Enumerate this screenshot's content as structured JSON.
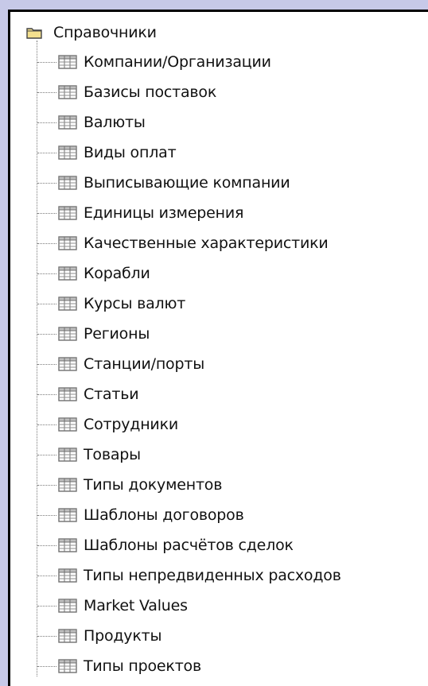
{
  "tree": {
    "root": {
      "label": "Справочники",
      "icon": "folder-icon"
    },
    "items": [
      {
        "label": "Компании/Организации",
        "icon": "table-icon"
      },
      {
        "label": "Базисы поставок",
        "icon": "table-icon"
      },
      {
        "label": "Валюты",
        "icon": "table-icon"
      },
      {
        "label": "Виды оплат",
        "icon": "table-icon"
      },
      {
        "label": "Выписывающие компании",
        "icon": "table-icon"
      },
      {
        "label": "Единицы измерения",
        "icon": "table-icon"
      },
      {
        "label": "Качественные характеристики",
        "icon": "table-icon"
      },
      {
        "label": "Корабли",
        "icon": "table-icon"
      },
      {
        "label": "Курсы валют",
        "icon": "table-icon"
      },
      {
        "label": "Регионы",
        "icon": "table-icon"
      },
      {
        "label": "Станции/порты",
        "icon": "table-icon"
      },
      {
        "label": "Статьи",
        "icon": "table-icon"
      },
      {
        "label": "Сотрудники",
        "icon": "table-icon"
      },
      {
        "label": "Товары",
        "icon": "table-icon"
      },
      {
        "label": "Типы документов",
        "icon": "table-icon"
      },
      {
        "label": "Шаблоны договоров",
        "icon": "table-icon"
      },
      {
        "label": "Шаблоны расчётов сделок",
        "icon": "table-icon"
      },
      {
        "label": "Типы непредвиденных расходов",
        "icon": "table-icon"
      },
      {
        "label": "Market Values",
        "icon": "table-icon"
      },
      {
        "label": "Продукты",
        "icon": "table-icon"
      },
      {
        "label": "Типы проектов",
        "icon": "table-icon"
      }
    ]
  },
  "colors": {
    "background": "#c7c9e8",
    "panel": "#ffffff",
    "border": "#000000",
    "folder_fill": "#f4e08e",
    "folder_stroke": "#444444",
    "table_header": "#ffffff",
    "table_stroke": "#707070"
  }
}
